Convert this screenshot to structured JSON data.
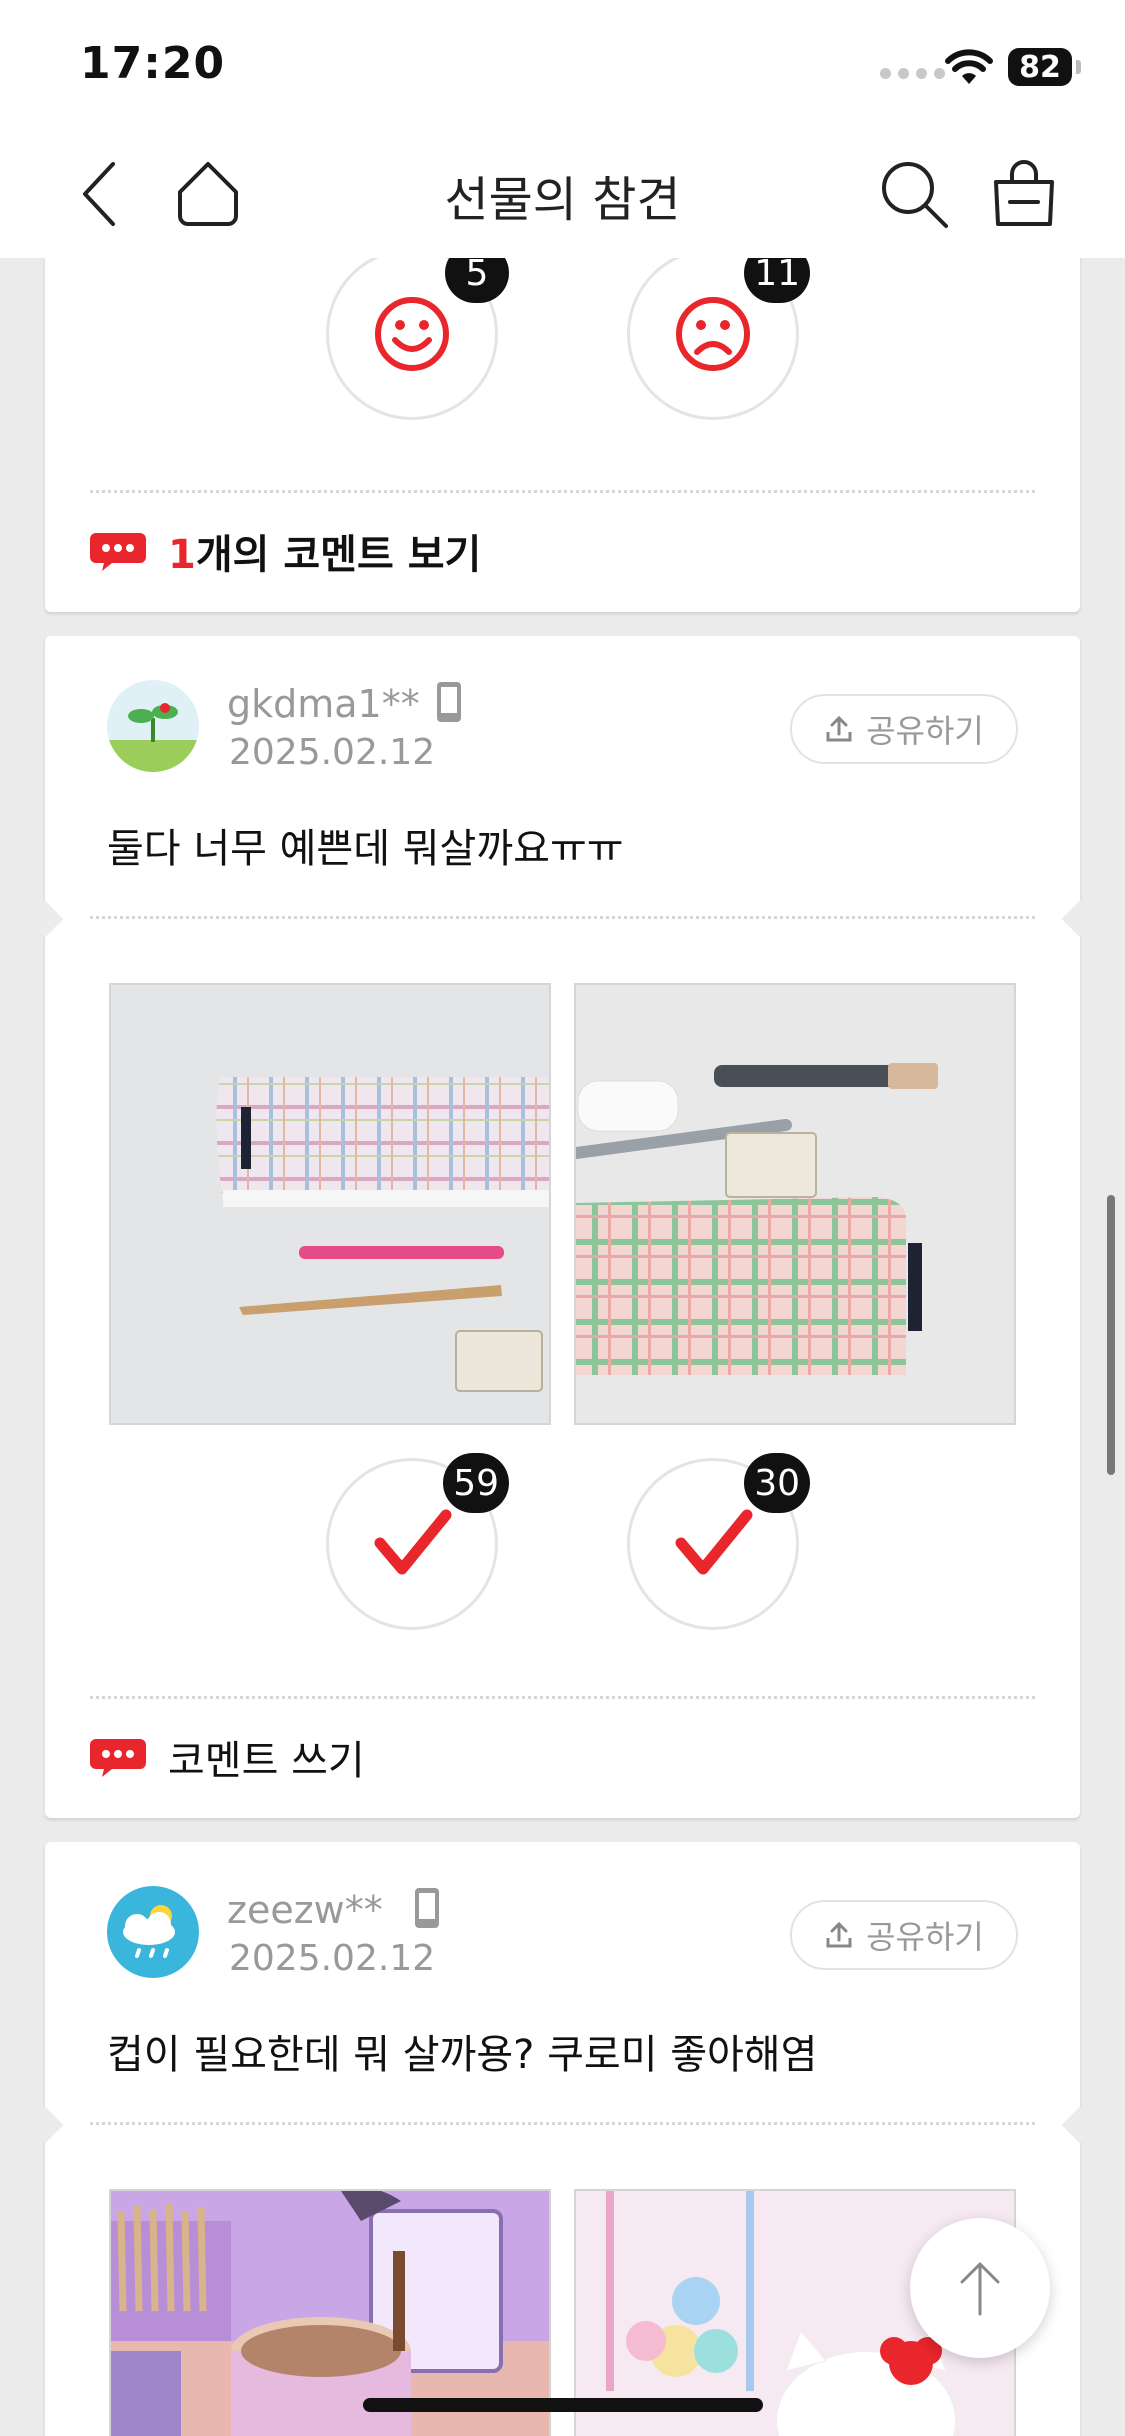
{
  "status_bar": {
    "time": "17:20",
    "battery": "82"
  },
  "nav": {
    "title": "선물의 참견"
  },
  "card1": {
    "votes": [
      {
        "icon": "smiley-face-icon",
        "count": "5"
      },
      {
        "icon": "sad-face-icon",
        "count": "11"
      }
    ],
    "comment_count": "1",
    "comment_suffix": "개의 코멘트 보기"
  },
  "post1": {
    "username": "gkdma1**",
    "date": "2025.02.12",
    "share_label": "공유하기",
    "text": "둘다 너무 예쁜데 뭐살까요ㅠㅠ",
    "votes": [
      {
        "icon": "checkmark-icon",
        "count": "59"
      },
      {
        "icon": "checkmark-icon",
        "count": "30"
      }
    ],
    "comment_label": "코멘트 쓰기"
  },
  "post2": {
    "username": "zeezw**",
    "date": "2025.02.12",
    "share_label": "공유하기",
    "text": "컵이 필요한데 뭐 살까용? 쿠로미 좋아해염"
  },
  "colors": {
    "accent_red": "#e8262b",
    "background": "#ebebeb"
  }
}
